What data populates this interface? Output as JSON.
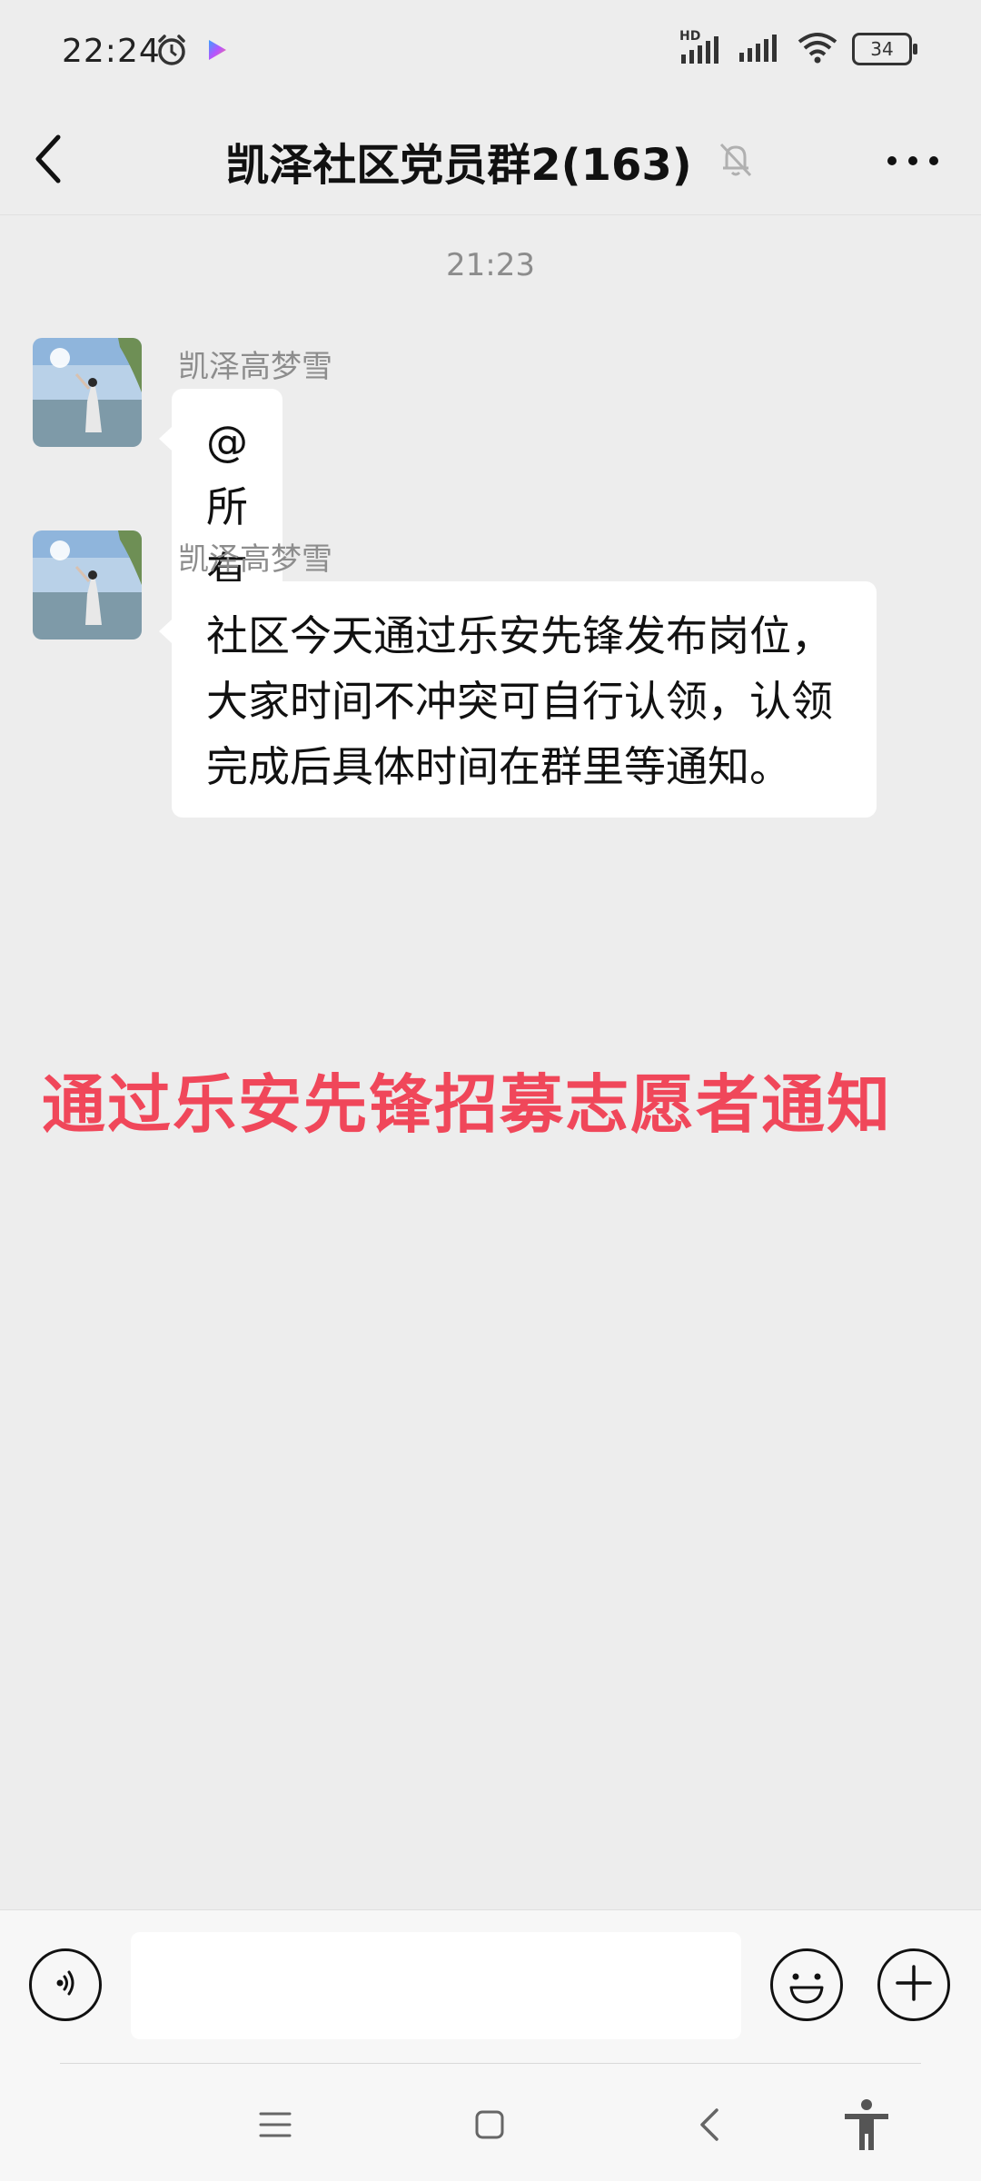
{
  "status_bar": {
    "time": "22:24",
    "network_label": "HD",
    "battery_level": "34",
    "icons": [
      "alarm-icon",
      "play-icon",
      "signal-icon",
      "signal-icon",
      "wifi-icon",
      "battery-icon"
    ]
  },
  "header": {
    "title": "凯泽社区党员群2(163)",
    "muted_icon": "bell-off-icon",
    "back_icon": "chevron-left-icon",
    "more_icon": "more-horizontal-icon"
  },
  "chat": {
    "time_divider": "21:23",
    "messages": [
      {
        "sender": "凯泽高梦雪",
        "text": "@所有人"
      },
      {
        "sender": "凯泽高梦雪",
        "text": "社区今天通过乐安先锋发布岗位，大家时间不冲突可自行认领，认领完成后具体时间在群里等通知。"
      }
    ],
    "overlay_caption": "通过乐安先锋招募志愿者通知"
  },
  "input_bar": {
    "placeholder": "",
    "voice_icon": "voice-icon",
    "emoji_icon": "emoji-icon",
    "plus_icon": "plus-icon"
  },
  "system_nav": {
    "icons": [
      "menu-icon",
      "home-icon",
      "back-icon",
      "accessibility-icon"
    ]
  },
  "colors": {
    "background": "#ededed",
    "bubble": "#ffffff",
    "overlay_text": "#f0475a",
    "secondary_text": "#8c8c8c"
  }
}
